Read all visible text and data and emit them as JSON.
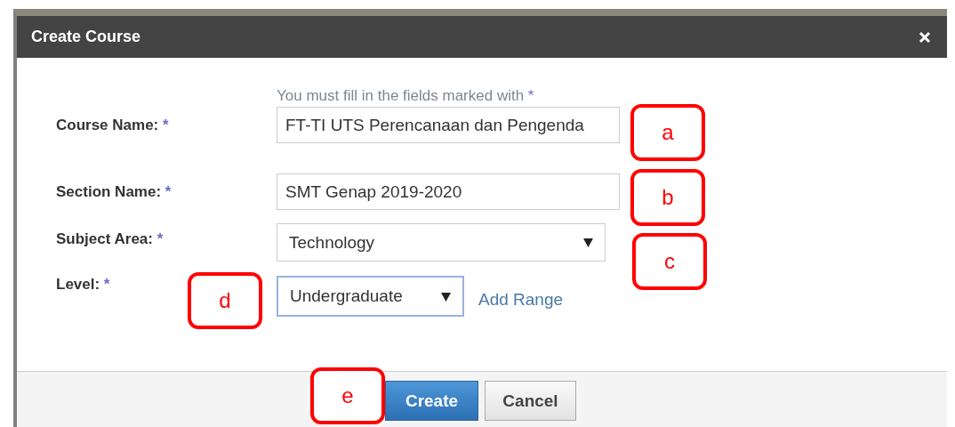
{
  "dialog": {
    "title": "Create Course",
    "hint": "You must fill in the fields marked with",
    "hint_mark": "*"
  },
  "fields": [
    {
      "kind": "text",
      "label": "Course Name:",
      "mark": "*",
      "value": "FT-TI UTS Perencanaan dan Pengenda",
      "focused": false
    },
    {
      "kind": "text",
      "label": "Section Name:",
      "mark": "*",
      "value": "SMT Genap 2019-2020",
      "focused": false
    },
    {
      "kind": "select",
      "label": "Subject Area:",
      "mark": "*",
      "value": "Technology",
      "focused": false
    },
    {
      "kind": "select",
      "label": "Level:",
      "mark": "*",
      "value": "Undergraduate",
      "focused": true,
      "link": "Add Range"
    }
  ],
  "buttons": [
    {
      "label": "Create",
      "kind": "primary"
    },
    {
      "label": "Cancel",
      "kind": "secondary"
    }
  ],
  "callouts": [
    {
      "letter": "a"
    },
    {
      "letter": "b"
    },
    {
      "letter": "c"
    },
    {
      "letter": "d"
    },
    {
      "letter": "e"
    }
  ]
}
